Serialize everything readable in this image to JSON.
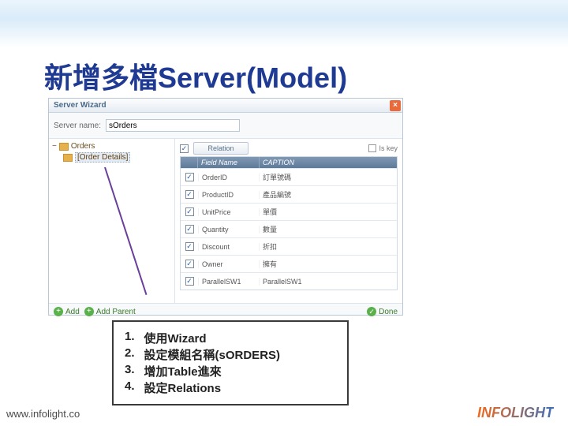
{
  "title": "新增多檔Server(Model)",
  "wizard": {
    "window_title": "Server Wizard",
    "name_label": "Server name:",
    "name_value": "sOrders",
    "tree": {
      "root": "Orders",
      "child": "[Order Details]"
    },
    "relation_btn": "Relation",
    "iskey_label": "Is key",
    "grid": {
      "head_field": "Field Name",
      "head_caption": "CAPTION",
      "rows": [
        {
          "field": "OrderID",
          "caption": "訂單號碼"
        },
        {
          "field": "ProductID",
          "caption": "產品編號"
        },
        {
          "field": "UnitPrice",
          "caption": "單價"
        },
        {
          "field": "Quantity",
          "caption": "數量"
        },
        {
          "field": "Discount",
          "caption": "折扣"
        },
        {
          "field": "Owner",
          "caption": "擁有"
        },
        {
          "field": "ParallelSW1",
          "caption": "ParallelSW1"
        }
      ]
    },
    "footer": {
      "add": "Add",
      "add_parent": "Add Parent",
      "done": "Done"
    }
  },
  "callout": {
    "items": [
      {
        "n": "1.",
        "t": "使用Wizard"
      },
      {
        "n": "2.",
        "t": "設定模組名稱(sORDERS)"
      },
      {
        "n": "3.",
        "t": "增加Table進來"
      },
      {
        "n": "4.",
        "t": "設定Relations"
      }
    ]
  },
  "site": "www.infolight.co",
  "logo": "INFOLIGHT"
}
